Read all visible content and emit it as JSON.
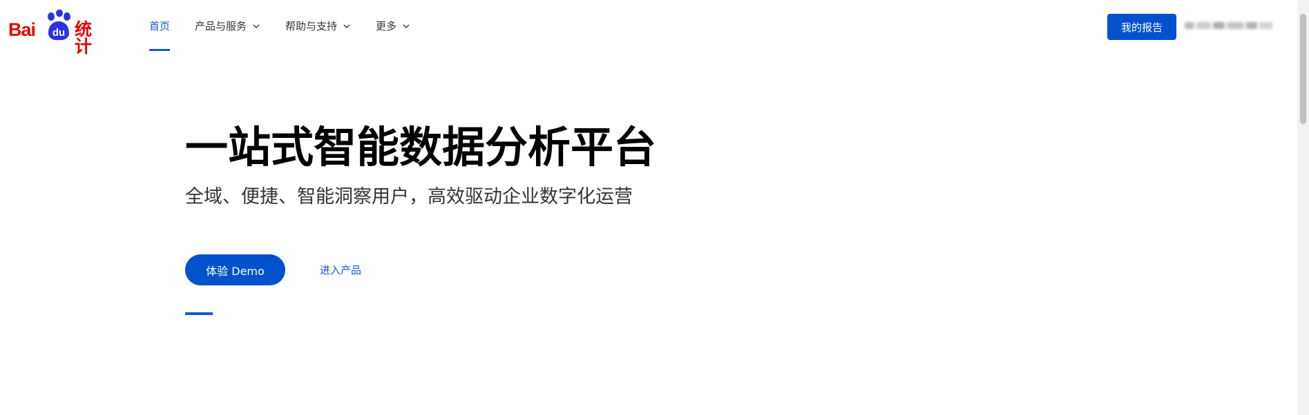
{
  "logo": {
    "brand_text": "Bai",
    "du_text": "du",
    "product_text": "统计"
  },
  "nav": {
    "items": [
      {
        "label": "首页",
        "active": true,
        "has_dropdown": false
      },
      {
        "label": "产品与服务",
        "active": false,
        "has_dropdown": true
      },
      {
        "label": "帮助与支持",
        "active": false,
        "has_dropdown": true
      },
      {
        "label": "更多",
        "active": false,
        "has_dropdown": true
      }
    ]
  },
  "header": {
    "report_button": "我的报告"
  },
  "hero": {
    "title": "一站式智能数据分析平台",
    "subtitle": "全域、便捷、智能洞察用户，高效驱动企业数字化运营",
    "demo_button": "体验 Demo",
    "enter_link": "进入产品"
  },
  "colors": {
    "brand_red": "#e10602",
    "paw_blue": "#2932e1",
    "primary_blue": "#0052cc",
    "link_blue": "#1558d6"
  },
  "icons": [
    "baidu-paw-icon",
    "chevron-down-icon"
  ]
}
